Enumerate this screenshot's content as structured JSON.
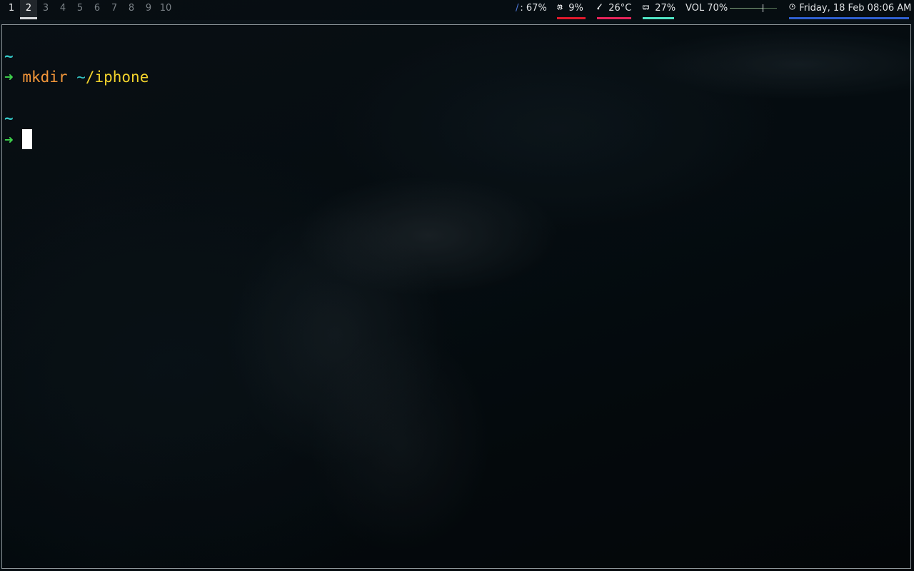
{
  "status_bar": {
    "workspaces": [
      {
        "label": "1",
        "state": "occupied"
      },
      {
        "label": "2",
        "state": "focused"
      },
      {
        "label": "3",
        "state": "empty"
      },
      {
        "label": "4",
        "state": "empty"
      },
      {
        "label": "5",
        "state": "empty"
      },
      {
        "label": "6",
        "state": "empty"
      },
      {
        "label": "7",
        "state": "empty"
      },
      {
        "label": "8",
        "state": "empty"
      },
      {
        "label": "9",
        "state": "empty"
      },
      {
        "label": "10",
        "state": "empty"
      }
    ],
    "disk": {
      "icon": "/",
      "value": ": 67%",
      "icon_color": "#4f7ae0"
    },
    "cpu": {
      "icon": "cpu-icon",
      "value": "9%",
      "color": "#e0192c"
    },
    "temperature": {
      "icon": "thermometer-icon",
      "value": "26°C",
      "color": "#e6245a"
    },
    "memory": {
      "icon": "memory-icon",
      "value": "27%",
      "color": "#4fe6c6"
    },
    "volume": {
      "label": "VOL 70%",
      "level": 0.7
    },
    "datetime": {
      "icon": "clock-icon",
      "value": "Friday, 18 Feb 08:06 AM",
      "color": "#2f5fd0"
    }
  },
  "terminal": {
    "history": [
      {
        "cwd": "~",
        "prompt": "➜",
        "command": "mkdir",
        "arg_tilde": "~",
        "arg_rest": "/iphone"
      }
    ],
    "current": {
      "cwd": "~",
      "prompt": "➜"
    },
    "colors": {
      "cwd": "#34c6c6",
      "prompt": "#3fd24c",
      "command": "#f2963a",
      "path": "#f2d32c"
    }
  }
}
